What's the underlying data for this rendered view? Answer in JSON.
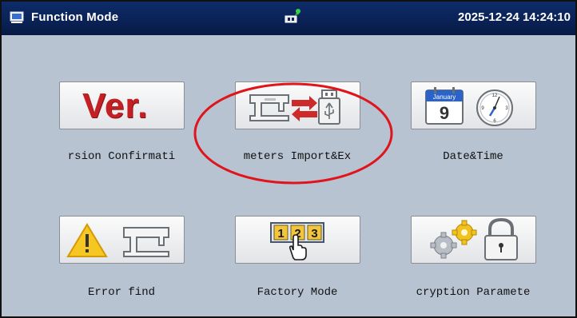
{
  "titlebar": {
    "title": "Function Mode",
    "datetime": "2025-12-24 14:24:10"
  },
  "buttons": [
    {
      "id": "version",
      "icon_text": "Ver.",
      "label": "rsion Confirmati"
    },
    {
      "id": "params",
      "label": "meters Import&Ex"
    },
    {
      "id": "datetime",
      "calendar_month": "January",
      "calendar_day": "9",
      "label": "Date&Time"
    },
    {
      "id": "error",
      "label": "Error find"
    },
    {
      "id": "factory",
      "icon_text": [
        "1",
        "2",
        "3"
      ],
      "label": "Factory Mode"
    },
    {
      "id": "encryption",
      "label": "cryption Paramete"
    }
  ],
  "colors": {
    "titlebar": "#0a2255",
    "background": "#b8c3d2",
    "highlight": "#e0141b",
    "ver_red": "#c42023"
  }
}
